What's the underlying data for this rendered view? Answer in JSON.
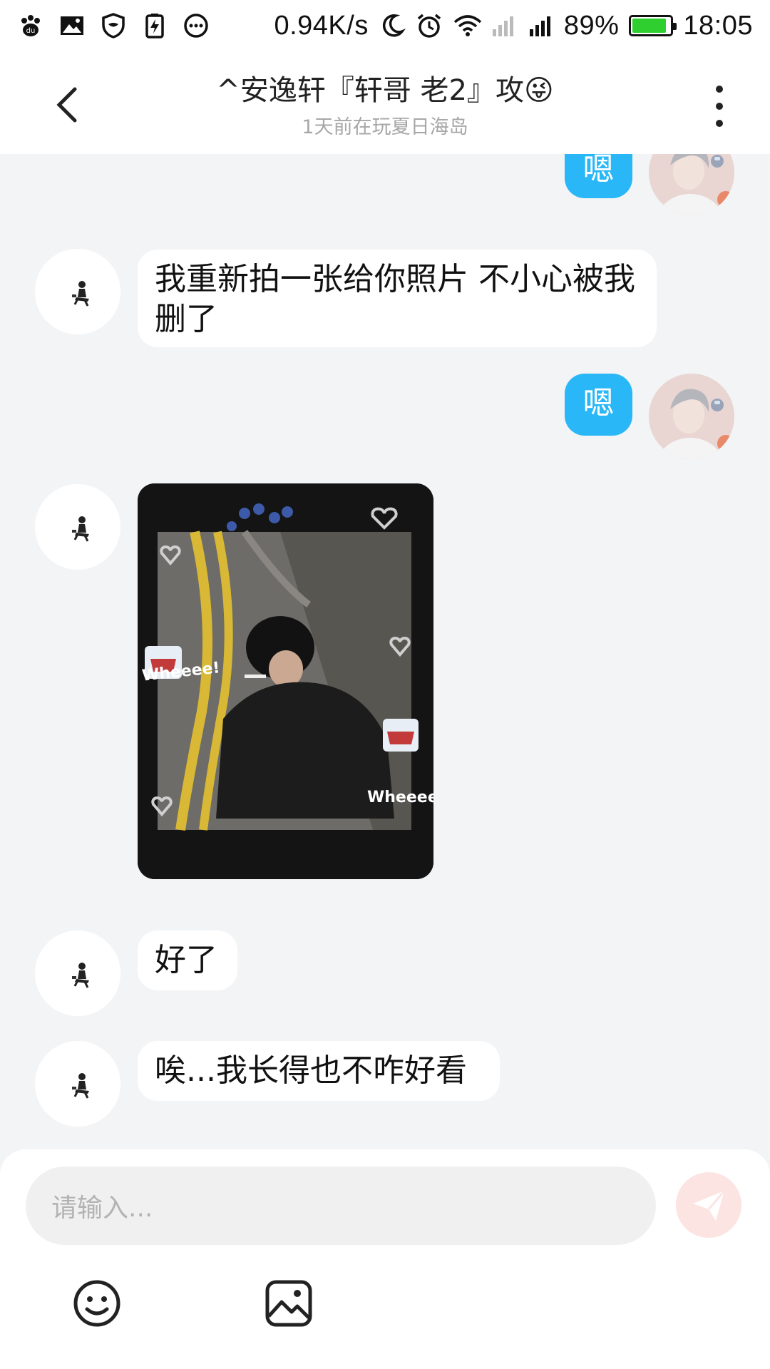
{
  "status_bar": {
    "speed": "0.94K/s",
    "battery": "89%",
    "battery_level": 0.89,
    "time": "18:05",
    "icons": [
      "paw-icon",
      "image-icon",
      "shield-icon",
      "battery-saver-icon",
      "chat-dots-icon",
      "moon-icon",
      "alarm-icon",
      "wifi-icon",
      "signal-weak-icon",
      "signal-icon"
    ]
  },
  "header": {
    "title": "^安逸轩『轩哥  老2』攻",
    "title_emoji": "😜",
    "subtitle": "1天前在玩夏日海岛"
  },
  "messages": [
    {
      "side": "right",
      "text": "嗯"
    },
    {
      "side": "left",
      "text": "我重新拍一张给你照片 不小心被我删了"
    },
    {
      "side": "right",
      "text": "嗯"
    },
    {
      "side": "left",
      "type": "image",
      "stickers": [
        "Wheeee!",
        "Wheeee!"
      ]
    },
    {
      "side": "left",
      "text": "好了"
    },
    {
      "side": "left",
      "text": "唉...我长得也不咋好看"
    }
  ],
  "input": {
    "placeholder": "请输入..."
  },
  "colors": {
    "accent_blue": "#29b7f7",
    "send_pink": "#f4a49a",
    "background": "#f3f4f6"
  }
}
